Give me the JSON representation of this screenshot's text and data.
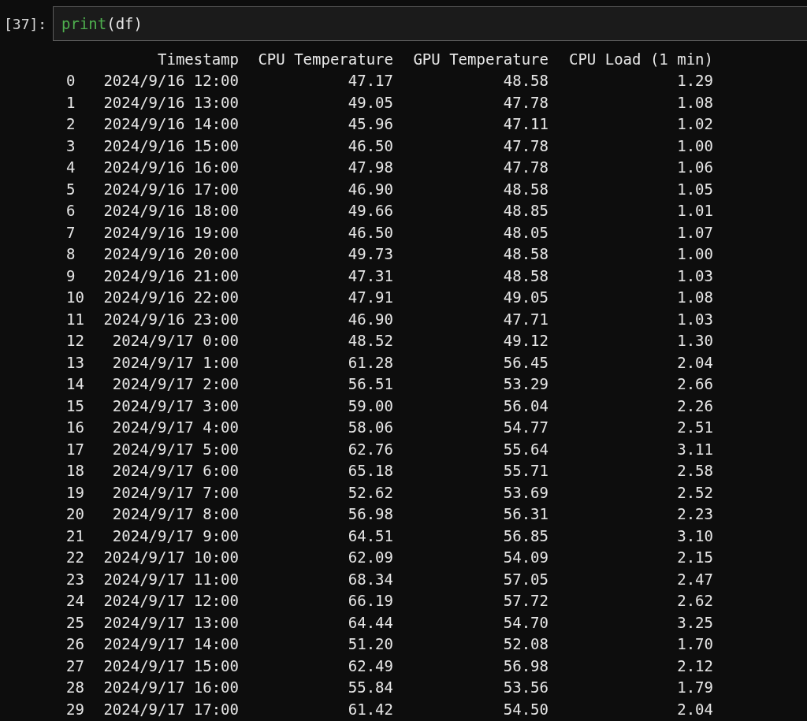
{
  "cell": {
    "prompt": "[37]:",
    "code": [
      {
        "text": "print",
        "kind": "builtin"
      },
      {
        "text": "(df)",
        "kind": "plain"
      }
    ]
  },
  "output": {
    "columns": [
      "",
      "Timestamp",
      "CPU Temperature",
      "GPU Temperature",
      "CPU Load (1 min)"
    ],
    "rows": [
      [
        "0",
        "2024/9/16 12:00",
        "47.17",
        "48.58",
        "1.29"
      ],
      [
        "1",
        "2024/9/16 13:00",
        "49.05",
        "47.78",
        "1.08"
      ],
      [
        "2",
        "2024/9/16 14:00",
        "45.96",
        "47.11",
        "1.02"
      ],
      [
        "3",
        "2024/9/16 15:00",
        "46.50",
        "47.78",
        "1.00"
      ],
      [
        "4",
        "2024/9/16 16:00",
        "47.98",
        "47.78",
        "1.06"
      ],
      [
        "5",
        "2024/9/16 17:00",
        "46.90",
        "48.58",
        "1.05"
      ],
      [
        "6",
        "2024/9/16 18:00",
        "49.66",
        "48.85",
        "1.01"
      ],
      [
        "7",
        "2024/9/16 19:00",
        "46.50",
        "48.05",
        "1.07"
      ],
      [
        "8",
        "2024/9/16 20:00",
        "49.73",
        "48.58",
        "1.00"
      ],
      [
        "9",
        "2024/9/16 21:00",
        "47.31",
        "48.58",
        "1.03"
      ],
      [
        "10",
        "2024/9/16 22:00",
        "47.91",
        "49.05",
        "1.08"
      ],
      [
        "11",
        "2024/9/16 23:00",
        "46.90",
        "47.71",
        "1.03"
      ],
      [
        "12",
        "2024/9/17 0:00",
        "48.52",
        "49.12",
        "1.30"
      ],
      [
        "13",
        "2024/9/17 1:00",
        "61.28",
        "56.45",
        "2.04"
      ],
      [
        "14",
        "2024/9/17 2:00",
        "56.51",
        "53.29",
        "2.66"
      ],
      [
        "15",
        "2024/9/17 3:00",
        "59.00",
        "56.04",
        "2.26"
      ],
      [
        "16",
        "2024/9/17 4:00",
        "58.06",
        "54.77",
        "2.51"
      ],
      [
        "17",
        "2024/9/17 5:00",
        "62.76",
        "55.64",
        "3.11"
      ],
      [
        "18",
        "2024/9/17 6:00",
        "65.18",
        "55.71",
        "2.58"
      ],
      [
        "19",
        "2024/9/17 7:00",
        "52.62",
        "53.69",
        "2.52"
      ],
      [
        "20",
        "2024/9/17 8:00",
        "56.98",
        "56.31",
        "2.23"
      ],
      [
        "21",
        "2024/9/17 9:00",
        "64.51",
        "56.85",
        "3.10"
      ],
      [
        "22",
        "2024/9/17 10:00",
        "62.09",
        "54.09",
        "2.15"
      ],
      [
        "23",
        "2024/9/17 11:00",
        "68.34",
        "57.05",
        "2.47"
      ],
      [
        "24",
        "2024/9/17 12:00",
        "66.19",
        "57.72",
        "2.62"
      ],
      [
        "25",
        "2024/9/17 13:00",
        "64.44",
        "54.70",
        "3.25"
      ],
      [
        "26",
        "2024/9/17 14:00",
        "51.20",
        "52.08",
        "1.70"
      ],
      [
        "27",
        "2024/9/17 15:00",
        "62.49",
        "56.98",
        "2.12"
      ],
      [
        "28",
        "2024/9/17 16:00",
        "55.84",
        "53.56",
        "1.79"
      ],
      [
        "29",
        "2024/9/17 17:00",
        "61.42",
        "54.50",
        "2.04"
      ]
    ]
  }
}
